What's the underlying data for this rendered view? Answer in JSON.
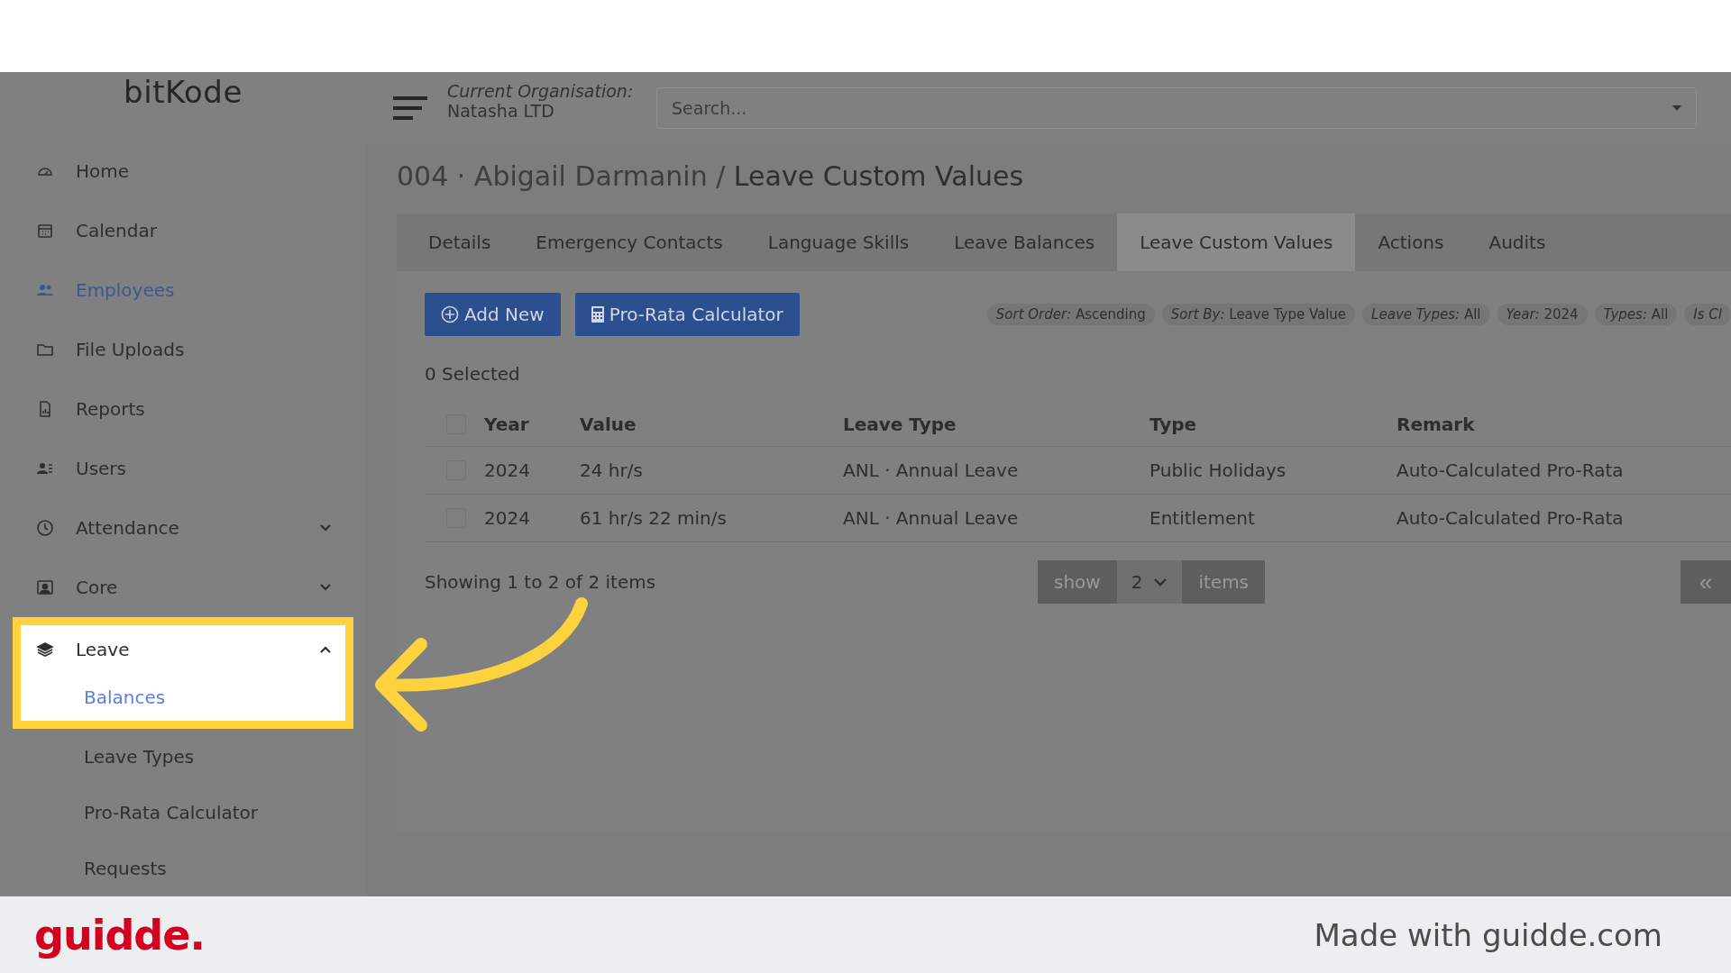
{
  "sidebar": {
    "logo": "bitKode",
    "items": [
      {
        "label": "Home",
        "kind": "link",
        "selected": false
      },
      {
        "label": "Calendar",
        "kind": "link",
        "selected": false
      },
      {
        "label": "Employees",
        "kind": "link",
        "selected": true
      },
      {
        "label": "File Uploads",
        "kind": "link",
        "selected": false
      },
      {
        "label": "Reports",
        "kind": "link",
        "selected": false
      },
      {
        "label": "Users",
        "kind": "link",
        "selected": false
      },
      {
        "label": "Attendance",
        "kind": "group",
        "expanded": false,
        "highlighted": false
      },
      {
        "label": "Core",
        "kind": "group",
        "expanded": false,
        "highlighted": false
      },
      {
        "label": "Leave",
        "kind": "group",
        "expanded": true,
        "highlighted": true,
        "children": [
          {
            "label": "Balances",
            "selected": true
          },
          {
            "label": "Leave Types",
            "selected": false
          },
          {
            "label": "Pro-Rata Calculator",
            "selected": false
          },
          {
            "label": "Requests",
            "selected": false
          }
        ]
      }
    ]
  },
  "header": {
    "org_label": "Current Organisation:",
    "org_name": "Natasha LTD",
    "search": {
      "placeholder": "Search..."
    }
  },
  "page": {
    "breadcrumb": "004 · Abigail Darmanin /",
    "title": "Leave Custom Values"
  },
  "tabs": [
    {
      "label": "Details",
      "selected": false
    },
    {
      "label": "Emergency Contacts",
      "selected": false
    },
    {
      "label": "Language Skills",
      "selected": false
    },
    {
      "label": "Leave Balances",
      "selected": false
    },
    {
      "label": "Leave Custom Values",
      "selected": true
    },
    {
      "label": "Actions",
      "selected": false
    },
    {
      "label": "Audits",
      "selected": false
    }
  ],
  "toolbar": {
    "buttons": [
      "Add New",
      "Pro-Rata Calculator"
    ],
    "filters": [
      "*Sort Order:* Ascending",
      "*Sort By:* Leave Type Value",
      "*Leave Types:* All",
      "*Year:* 2024",
      "*Types:* All",
      "*Is Cl*"
    ]
  },
  "selection": "0 Selected",
  "table": {
    "all_checked": false,
    "columns": [
      "Year",
      "Value",
      "Leave Type",
      "Type",
      "Remark"
    ],
    "rows": [
      {
        "checked": false,
        "cells": [
          "2024",
          "24 hr/s",
          "ANL · Annual Leave",
          "Public Holidays",
          "Auto-Calculated Pro-Rata"
        ]
      },
      {
        "checked": false,
        "cells": [
          "2024",
          "61 hr/s 22 min/s",
          "ANL · Annual Leave",
          "Entitlement",
          "Auto-Calculated Pro-Rata"
        ]
      }
    ]
  },
  "pagination": {
    "summary": "Showing 1 to 2 of 2 items",
    "show": "show",
    "page_size": "2",
    "items": "items",
    "first": "«"
  },
  "footer": {
    "logo": "guidde.",
    "credit": "Made with guidde.com"
  }
}
